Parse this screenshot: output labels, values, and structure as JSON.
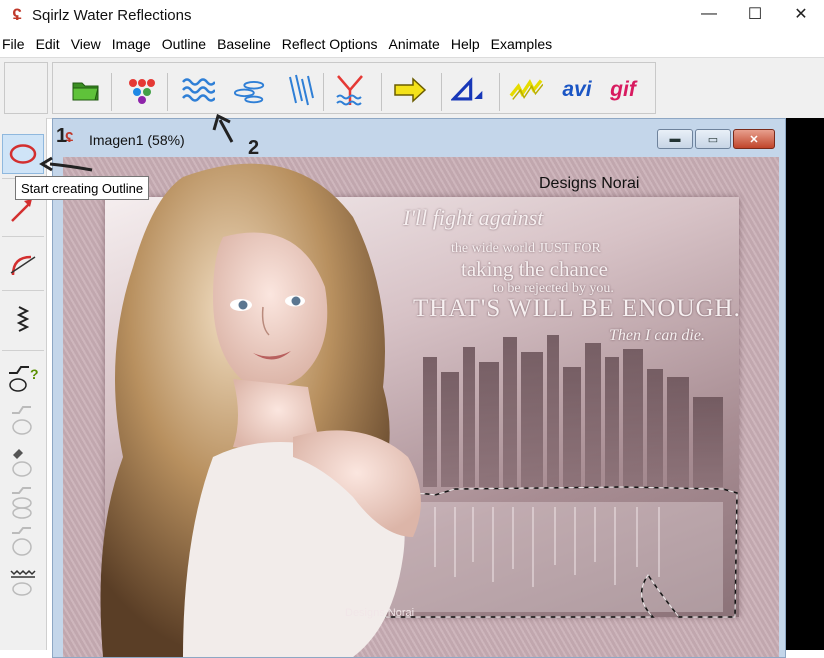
{
  "app": {
    "title": "Sqirlz Water Reflections",
    "icon": "squirrel-app-icon"
  },
  "window_controls": {
    "minimize": "—",
    "maximize": "☐",
    "close": "✕"
  },
  "menu": [
    "File",
    "Edit",
    "View",
    "Image",
    "Outline",
    "Baseline",
    "Reflect Options",
    "Animate",
    "Help",
    "Examples"
  ],
  "toolbar": {
    "buttons": [
      {
        "name": "open-folder-icon"
      },
      {
        "name": "color-dots-icon"
      },
      {
        "name": "water-waves-icon"
      },
      {
        "name": "ripples-icon"
      },
      {
        "name": "rain-streaks-icon"
      },
      {
        "name": "reflect-fork-icon"
      },
      {
        "name": "arrow-right-icon"
      },
      {
        "name": "perspective-triangle-icon"
      },
      {
        "name": "zigzag-icon"
      }
    ],
    "avi_label": "avi",
    "gif_label": "gif"
  },
  "tooltip": "Start creating Outline",
  "child_window": {
    "title": "Imagen1  (58%)"
  },
  "canvas": {
    "watermark_top": "Designs Norai",
    "watermark_bottom": "Designs Norai",
    "poem": {
      "line1": "I'll fight against",
      "line2": "the wide world JUST FOR",
      "line3": "taking the chance",
      "line4": "to be rejected by you.",
      "line5": "THAT'S WILL BE ENOUGH.",
      "line6": "Then I can die."
    }
  },
  "annotations": [
    "1",
    "2"
  ],
  "colors": {
    "accent_blue": "#2f7fd6",
    "accent_red": "#c0392b",
    "avi_blue": "#1a55c4",
    "gif_magenta": "#d81b60"
  }
}
